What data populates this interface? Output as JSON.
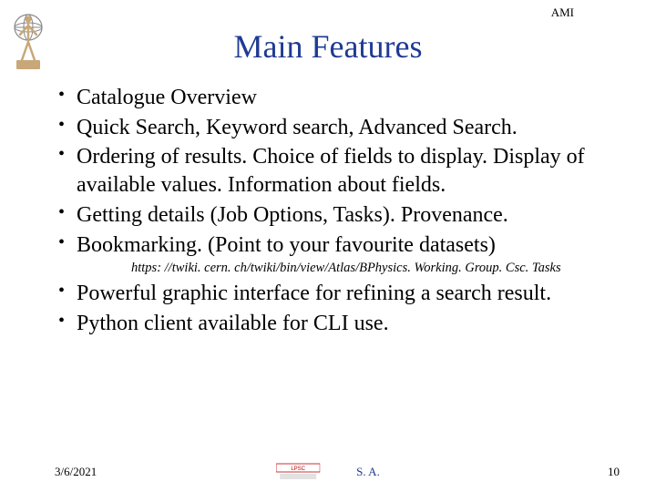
{
  "header_label": "AMI",
  "title": "Main Features",
  "bullets_before": [
    "Catalogue Overview",
    "Quick Search, Keyword search, Advanced Search.",
    "Ordering of results. Choice of fields to display. Display of available values. Information about fields.",
    "Getting details (Job Options, Tasks). Provenance.",
    "Bookmarking. (Point to your favourite datasets)"
  ],
  "url_line": "https: //twiki. cern. ch/twiki/bin/view/Atlas/BPhysics. Working. Group. Csc. Tasks",
  "bullets_after": [
    "Powerful graphic interface for refining a search result.",
    "Python client available for CLI use."
  ],
  "footer": {
    "date": "3/6/2021",
    "center": "S. A.",
    "page": "10"
  }
}
